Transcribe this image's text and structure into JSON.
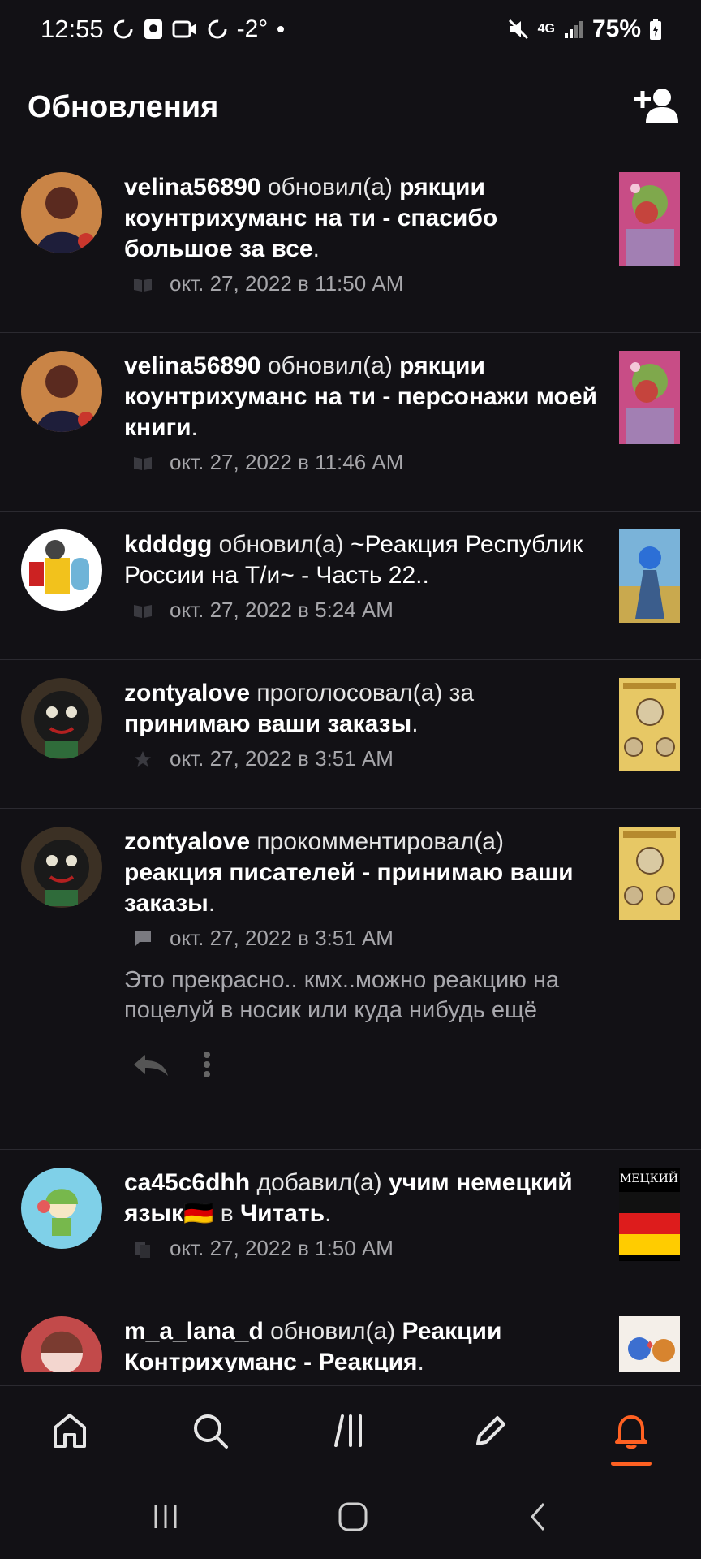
{
  "status": {
    "time": "12:55",
    "temp": "-2°",
    "network": "4G",
    "battery": "75%"
  },
  "header": {
    "title": "Обновления",
    "add_user_icon": "add-user-icon"
  },
  "feed": [
    {
      "user": "velina56890",
      "verb": "обновил(а)",
      "target": "рякции коунтрихуманс на ти - спасибо большое за все",
      "suffix": ".",
      "meta_icon": "book-icon",
      "time": "окт. 27, 2022 в 11:50 AM"
    },
    {
      "user": "velina56890",
      "verb": "обновил(а)",
      "target": "рякции коунтрихуманс на ти - персонажи моей книги",
      "suffix": ".",
      "meta_icon": "book-icon",
      "time": "окт. 27, 2022 в 11:46 AM"
    },
    {
      "user": "kdddgg",
      "verb": "обновил(а)",
      "target": "~Реакция Республик России на Т/и~ - Часть 22..",
      "suffix": "",
      "meta_icon": "book-icon",
      "time": "окт. 27, 2022 в 5:24 AM"
    },
    {
      "user": "zontyalove",
      "verb": "проголосовал(а) за",
      "target": "принимаю ваши заказы",
      "suffix": ".",
      "meta_icon": "star-icon",
      "time": "окт. 27, 2022 в 3:51 AM"
    },
    {
      "user": "zontyalove",
      "verb": "прокомментировал(а)",
      "target": "реакция писателей - принимаю ваши заказы",
      "suffix": ".",
      "meta_icon": "comment-icon",
      "time": "окт. 27, 2022 в 3:51 AM",
      "comment": "Это прекрасно.. кмх..можно реакцию на поцелуй в носик или куда нибудь ещё"
    },
    {
      "user": "ca45c6dhh",
      "verb": "добавил(а)",
      "target": "учим немецкий язык🇩🇪",
      "middle": "в",
      "target2": "Читать",
      "suffix": ".",
      "meta_icon": "library-icon",
      "time": "окт. 27, 2022 в 1:50 AM",
      "thumb_text": "МЕЦКИЙ ЯЗ"
    },
    {
      "user": "m_a_lana_d",
      "verb": "обновил(а)",
      "target": "Реакции Контрихуманс - Реакция",
      "suffix": ".",
      "meta_icon": "book-icon",
      "time": ""
    }
  ],
  "nav": {
    "items": [
      "home-icon",
      "search-icon",
      "library-icon",
      "write-icon",
      "notifications-icon"
    ],
    "active": "notifications-icon",
    "accent": "#ff6122"
  }
}
